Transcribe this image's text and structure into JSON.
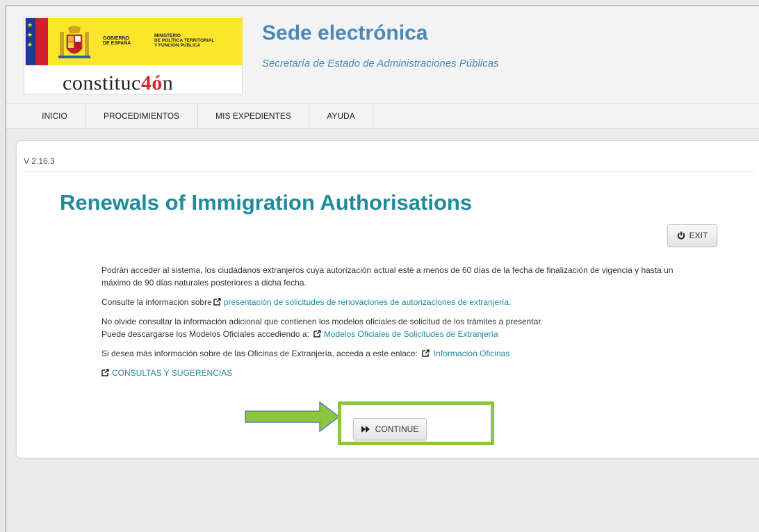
{
  "header": {
    "logo": {
      "gov_lines": [
        "GOBIERNO",
        "DE ESPAÑA"
      ],
      "ministry_lines": [
        "MINISTERIO",
        "DE POLÍTICA TERRITORIAL",
        "Y FUNCIÓN PÚBLICA"
      ],
      "constitucion_pre": "constituc",
      "constitucion_hl": "4ó",
      "constitucion_post": "n"
    },
    "title": "Sede electrónica",
    "subtitle": "Secretaría de Estado de Administraciones Públicas"
  },
  "nav": {
    "items": [
      "INICIO",
      "PROCEDIMIENTOS",
      "MIS EXPEDIENTES",
      "AYUDA"
    ]
  },
  "main": {
    "version": "V 2.16.3",
    "title": "Renewals of Immigration Authorisations",
    "exit_label": "EXIT",
    "paragraph1": "Podrán acceder al sistema, los ciudadanos extranjeros cuya autorización actual esté a menos de 60 días de la fecha de finalización de vigencia y hasta un máximo de 90 días naturales posteriores a dicha fecha.",
    "consult_prefix": "Consulte la información sobre",
    "consult_link": "presentación de solicitudes de renovaciones de autorizaciones de extranjería.",
    "additional_info": "No olvide consultar la información adicional que contienen los modelos oficiales de solicitud de los trámites a presentar.",
    "download_prefix": "Puede descargarse los Modelos Oficiales accediendo a:",
    "download_link": "Modelos Oficiales de Solicitudes de Extranjería",
    "offices_prefix": "Si desea más información sobre de las Oficinas de Extranjería, acceda a este enlace:",
    "offices_link": "Información Oficinas",
    "consultas_link": "CONSULTAS Y SUGERENCIAS",
    "continue_label": "CONTINUE"
  },
  "colors": {
    "accent": "#1f8a9c",
    "header_title": "#4a88b5",
    "highlight": "#8cc63f",
    "arrow": "#8cc63f"
  }
}
